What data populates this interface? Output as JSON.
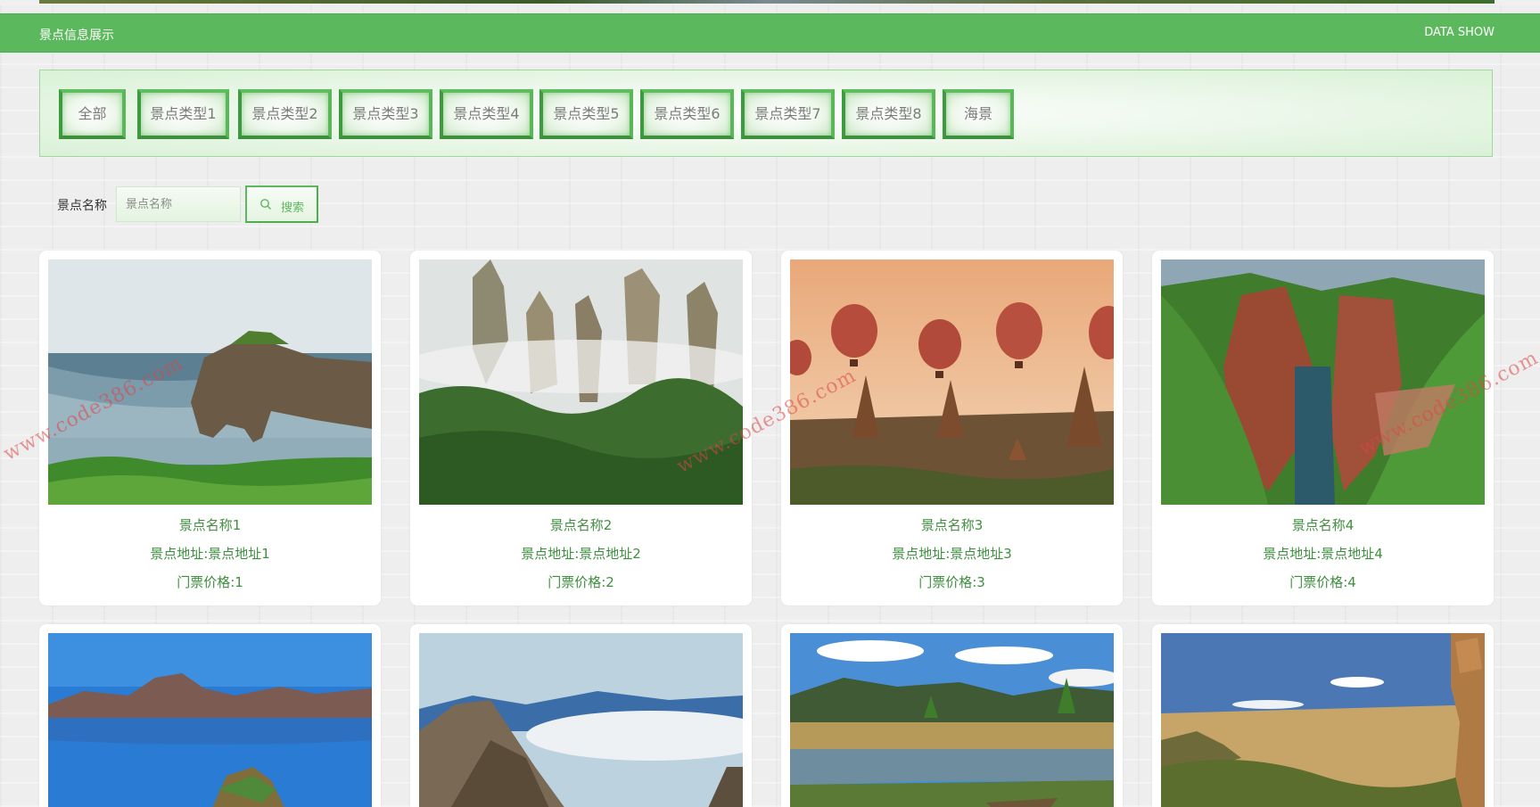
{
  "header": {
    "left_title": "景点信息展示",
    "right_title": "DATA SHOW"
  },
  "categories": [
    "全部",
    "景点类型1",
    "景点类型2",
    "景点类型3",
    "景点类型4",
    "景点类型5",
    "景点类型6",
    "景点类型7",
    "景点类型8",
    "海景"
  ],
  "search": {
    "label": "景点名称",
    "placeholder": "景点名称",
    "button_label": "搜索",
    "icon": "search-icon"
  },
  "cards": [
    {
      "name": "景点名称1",
      "address": "景点地址:景点地址1",
      "price": "门票价格:1",
      "scene": "sea-arch"
    },
    {
      "name": "景点名称2",
      "address": "景点地址:景点地址2",
      "price": "门票价格:2",
      "scene": "karst-peaks"
    },
    {
      "name": "景点名称3",
      "address": "景点地址:景点地址3",
      "price": "门票价格:3",
      "scene": "balloons-pagodas"
    },
    {
      "name": "景点名称4",
      "address": "景点地址:景点地址4",
      "price": "门票价格:4",
      "scene": "green-canyon"
    },
    {
      "name": "",
      "address": "",
      "price": "",
      "scene": "blue-lake"
    },
    {
      "name": "",
      "address": "",
      "price": "",
      "scene": "cloud-mountains"
    },
    {
      "name": "",
      "address": "",
      "price": "",
      "scene": "wetland"
    },
    {
      "name": "",
      "address": "",
      "price": "",
      "scene": "coastal-rocks"
    }
  ],
  "watermark_text": "www.code386.com",
  "colors": {
    "primary_green": "#5cb85c",
    "text_green": "#3f8f3f",
    "watermark_red": "#dc4646"
  }
}
